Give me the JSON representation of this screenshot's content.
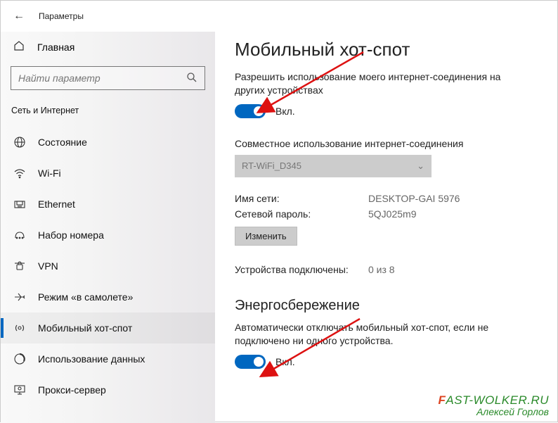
{
  "header": {
    "title": "Параметры"
  },
  "sidebar": {
    "home": "Главная",
    "search_placeholder": "Найти параметр",
    "category": "Сеть и Интернет",
    "items": [
      {
        "label": "Состояние"
      },
      {
        "label": "Wi-Fi"
      },
      {
        "label": "Ethernet"
      },
      {
        "label": "Набор номера"
      },
      {
        "label": "VPN"
      },
      {
        "label": "Режим «в самолете»"
      },
      {
        "label": "Мобильный хот-спот",
        "selected": true
      },
      {
        "label": "Использование данных"
      },
      {
        "label": "Прокси-сервер"
      }
    ]
  },
  "main": {
    "title": "Мобильный хот-спот",
    "share_desc": "Разрешить использование моего интернет-соединения на других устройствах",
    "toggle1_on": true,
    "toggle1_label": "Вкл.",
    "share_conn_label": "Совместное использование интернет-соединения",
    "share_conn_value": "RT-WiFi_D345",
    "net_name_label": "Имя сети:",
    "net_name_value": "DESKTOP-GAI 5976",
    "net_pass_label": "Сетевой пароль:",
    "net_pass_value": "5QJ025m9",
    "edit_button": "Изменить",
    "devices_label": "Устройства подключены:",
    "devices_value": "0 из 8",
    "power_title": "Энергосбережение",
    "power_desc": "Автоматически отключать мобильный хот-спот, если не подключено ни одного устройства.",
    "toggle2_on": true,
    "toggle2_label": "Вкл."
  },
  "watermark": {
    "line1_pre": "F",
    "line1_rest": "AST-WOLKER.RU",
    "line2": "Алексей Горлов"
  }
}
